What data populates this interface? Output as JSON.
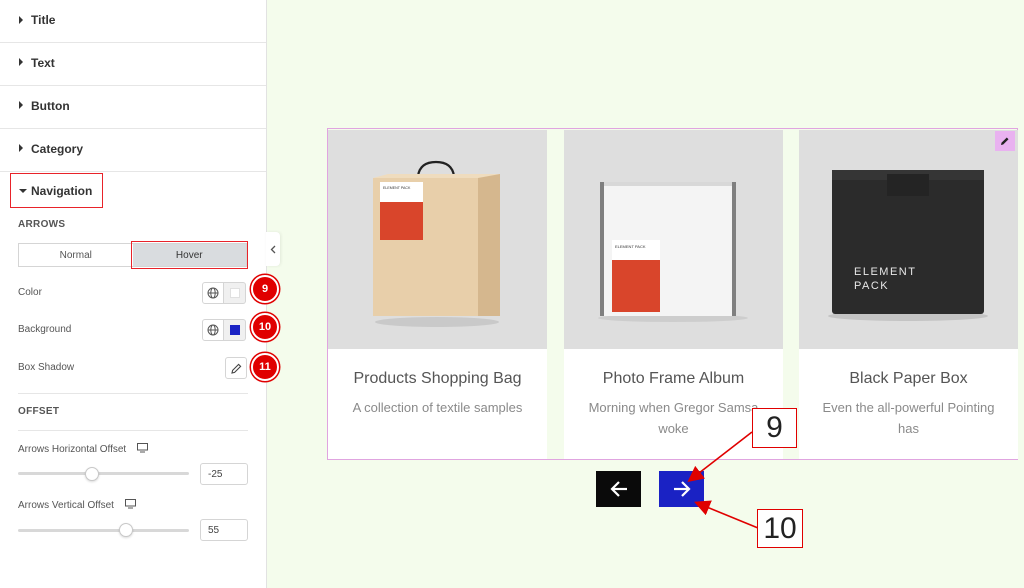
{
  "panel": {
    "sections": [
      "Title",
      "Text",
      "Button",
      "Category"
    ],
    "navigation_label": "Navigation",
    "arrows_heading": "ARROWS",
    "tabs": [
      {
        "label": "Normal",
        "active": false
      },
      {
        "label": "Hover",
        "active": true
      }
    ],
    "color_label": "Color",
    "color_value": "#ffffff",
    "background_label": "Background",
    "background_value": "#1a22c4",
    "box_shadow_label": "Box Shadow",
    "badges": [
      "9",
      "10",
      "11"
    ],
    "offset_heading": "OFFSET",
    "h_offset_label": "Arrows Horizontal Offset",
    "h_offset_value": "-25",
    "v_offset_label": "Arrows Vertical Offset",
    "v_offset_value": "55"
  },
  "products": [
    {
      "title": "Products Shopping Bag",
      "desc": "A collection of textile samples"
    },
    {
      "title": "Photo Frame Album",
      "desc": "Morning when Gregor Samsa woke"
    },
    {
      "title": "Black Paper Box",
      "desc": "Even the all-powerful Pointing has"
    }
  ],
  "package_labels": {
    "bag": "ELEMENT PACK",
    "frame": "ELEMENT PACK",
    "box_line1": "ELEMENT",
    "box_line2": "PACK"
  },
  "callouts": [
    "9",
    "10"
  ],
  "colors": {
    "accent_red": "#e00000",
    "arrow_prev_bg": "#0a0a0a",
    "arrow_next_bg": "#1a22c4"
  }
}
